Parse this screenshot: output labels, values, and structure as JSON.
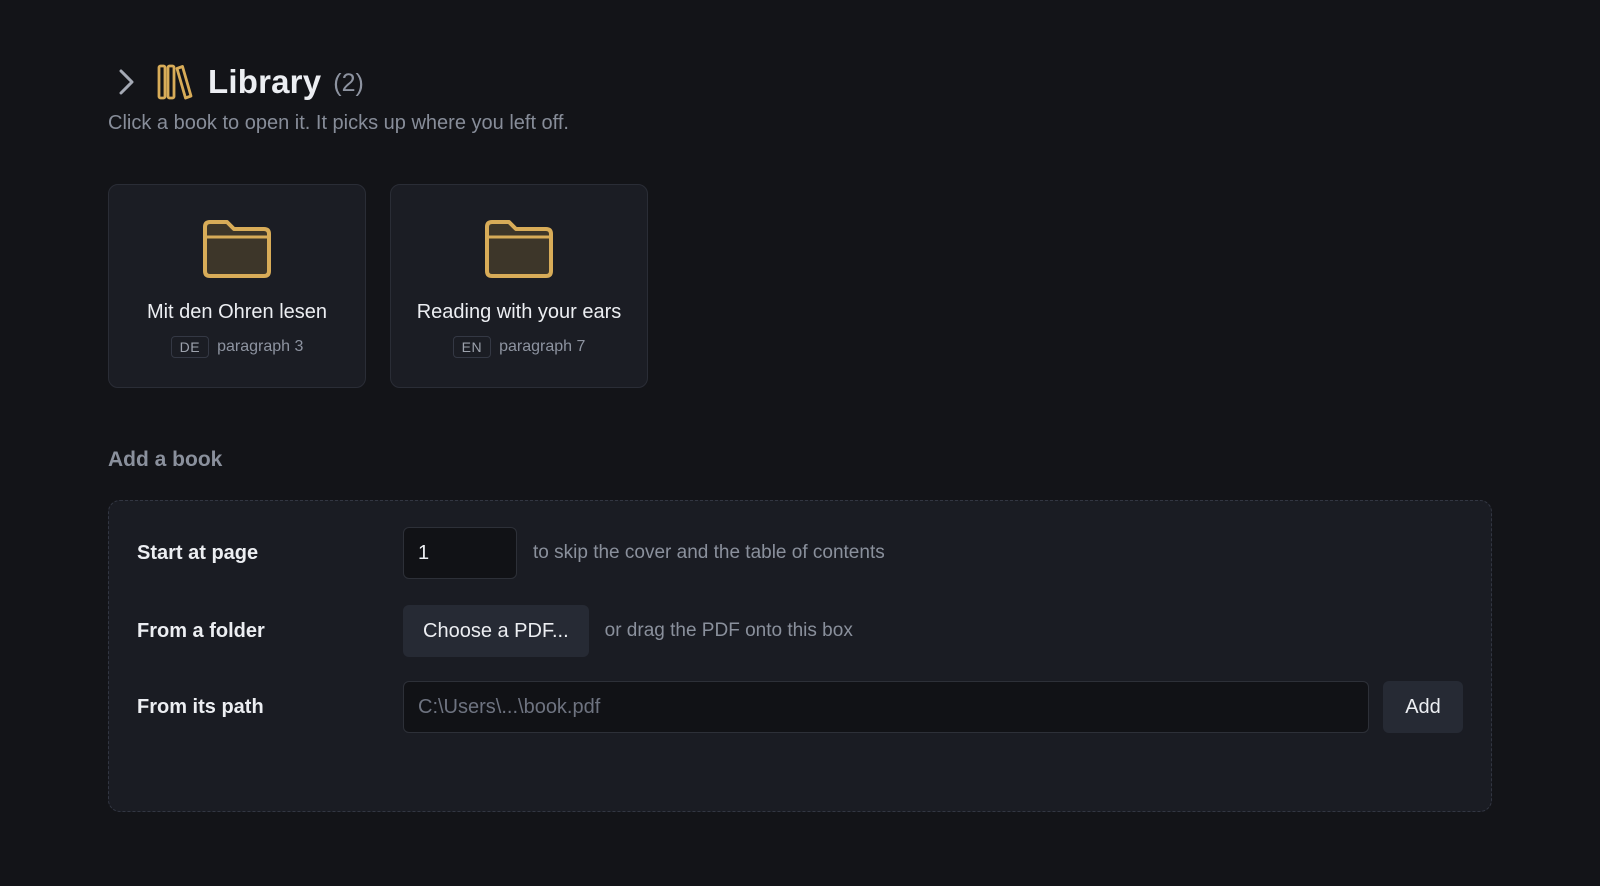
{
  "header": {
    "title": "Library",
    "count": "(2)",
    "subtitle": "Click a book to open it. It picks up where you left off.",
    "icons": {
      "toggle": "chevron-right-icon",
      "library": "library-books-icon"
    },
    "accent": "#d8ac58"
  },
  "books": [
    {
      "title": "Mit den Ohren lesen",
      "lang": "DE",
      "progress": "paragraph 3",
      "icon": "folder-icon"
    },
    {
      "title": "Reading with your ears",
      "lang": "EN",
      "progress": "paragraph 7",
      "icon": "folder-icon"
    }
  ],
  "add_book": {
    "heading": "Add a book",
    "start_page": {
      "label": "Start at page",
      "value": "1",
      "hint": "to skip the cover and the table of contents"
    },
    "folder": {
      "label": "From a folder",
      "button": "Choose a PDF...",
      "hint": "or drag the PDF onto this box"
    },
    "path": {
      "label": "From its path",
      "placeholder": "C:\\Users\\...\\book.pdf",
      "button": "Add"
    }
  }
}
